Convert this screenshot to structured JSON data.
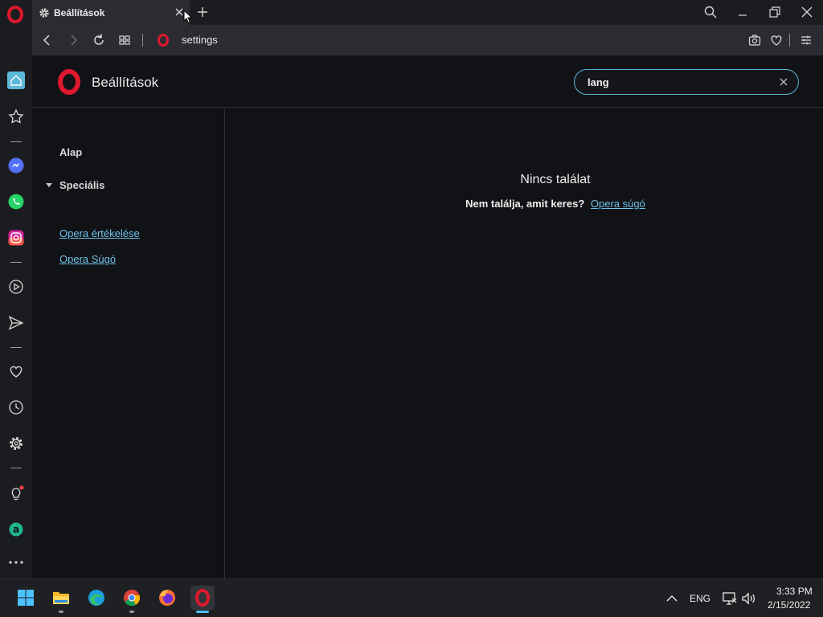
{
  "browser": {
    "tab": {
      "title": "Beállítások",
      "icon": "gear-icon"
    },
    "address": {
      "url": "settings"
    }
  },
  "settings": {
    "header_title": "Beállítások",
    "search": {
      "value": "lang",
      "placeholder": ""
    },
    "nav": {
      "basic": "Alap",
      "advanced": "Speciális",
      "rate_opera": "Opera értékelése",
      "opera_help": "Opera Súgó"
    },
    "results": {
      "none": "Nincs találat",
      "question": "Nem találja, amit keres?",
      "help_link": "Opera súgó"
    }
  },
  "sidebar_icons": [
    "home-icon",
    "bookmarks-icon",
    "messenger-icon",
    "whatsapp-icon",
    "instagram-icon",
    "player-icon",
    "flow-icon",
    "my-flow-heart-icon",
    "history-icon",
    "settings-icon",
    "tips-icon",
    "aria-icon",
    "more-icon"
  ],
  "taskbar": {
    "apps": [
      "windows-start-icon",
      "file-explorer-icon",
      "edge-icon",
      "chrome-icon",
      "firefox-icon",
      "opera-icon"
    ],
    "language": "ENG",
    "time": "3:33 PM",
    "date": "2/15/2022"
  },
  "colors": {
    "accent": "#5bb8d8",
    "link": "#6fc3ea",
    "opera_red": "#e0182d"
  }
}
